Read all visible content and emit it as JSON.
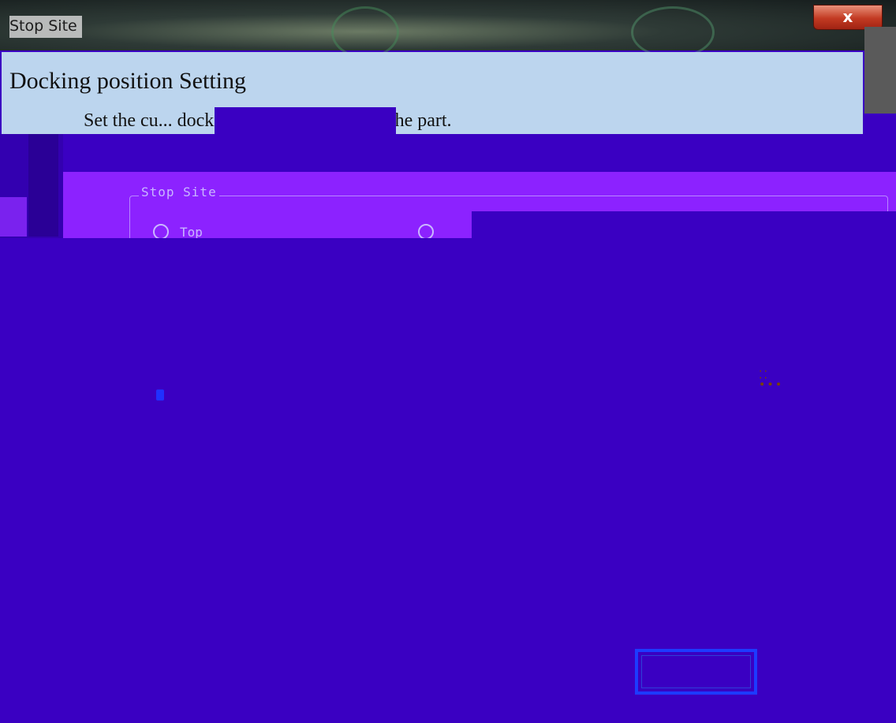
{
  "window": {
    "title": "Stop Site",
    "close_label": "x"
  },
  "header": {
    "title": "Docking position Setting",
    "subtitle": "Set the cu... docking position relative to the part."
  },
  "group": {
    "label": "Stop Site",
    "options": [
      {
        "label": "Top"
      }
    ]
  }
}
